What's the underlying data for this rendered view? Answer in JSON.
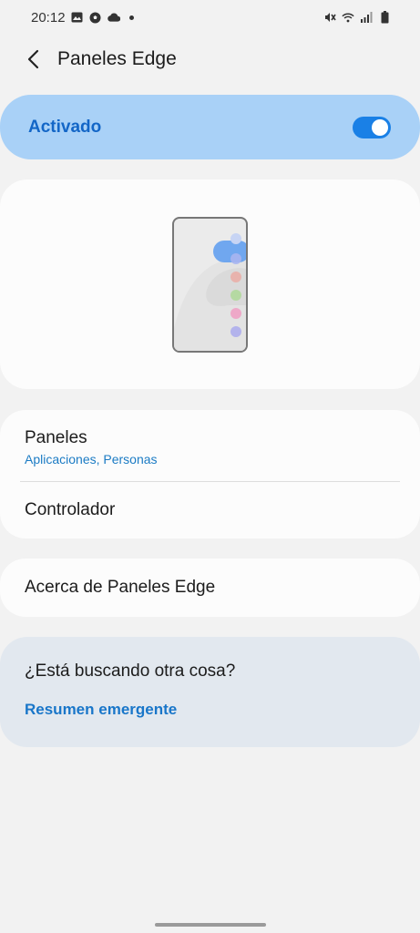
{
  "status_bar": {
    "time": "20:12",
    "left_icons": [
      "image-icon",
      "soccer-ball-icon",
      "cloud-icon",
      "dot-icon"
    ],
    "right_icons": [
      "mute-icon",
      "wifi-icon",
      "signal-icon",
      "battery-icon"
    ]
  },
  "header": {
    "title": "Paneles Edge",
    "back_icon": "chevron-left-icon"
  },
  "master_switch": {
    "label": "Activado",
    "enabled": true,
    "accent": "#1a80e6"
  },
  "preview": {
    "panel_dot_colors": [
      "#a8b5f0",
      "#e8b3ad",
      "#b5d9a2",
      "#eea8c8",
      "#b3b3ec"
    ],
    "handle_color": "#5b9bf0"
  },
  "settings": {
    "panels": {
      "title": "Paneles",
      "subtitle": "Aplicaciones, Personas"
    },
    "handle": {
      "title": "Controlador"
    },
    "about": {
      "title": "Acerca de Paneles Edge"
    }
  },
  "suggestion": {
    "title": "¿Está buscando otra cosa?",
    "link": "Resumen emergente"
  }
}
